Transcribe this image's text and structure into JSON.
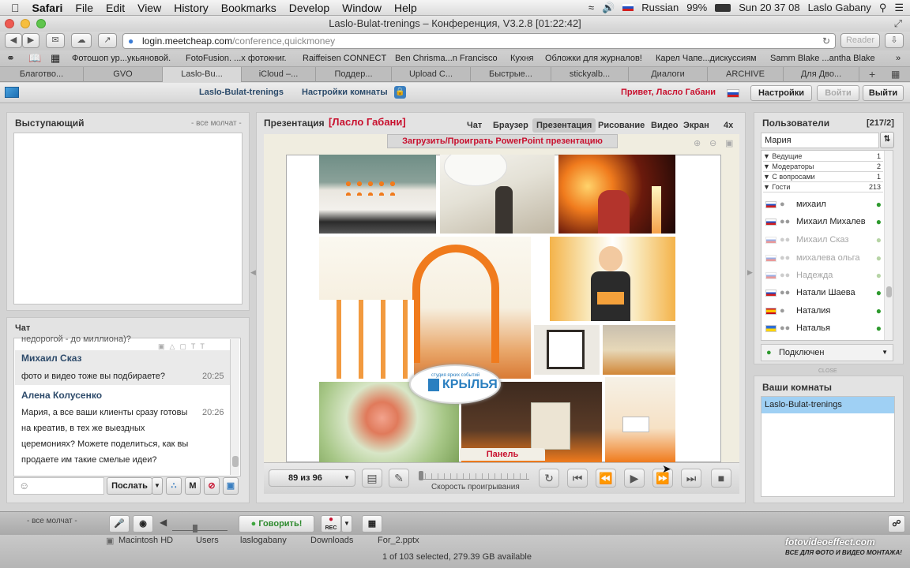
{
  "menubar": {
    "app": "Safari",
    "items": [
      "File",
      "Edit",
      "View",
      "History",
      "Bookmarks",
      "Develop",
      "Window",
      "Help"
    ],
    "language": "Russian",
    "battery": "99%",
    "clock": "Sun 20 37 08",
    "user": "Laslo Gabany"
  },
  "window": {
    "title": "Laslo-Bulat-trenings – Конференция, V3.2.8 [01:22:42]"
  },
  "toolbar": {
    "url_host": "login.meetcheap.com",
    "url_path": "/conference,quickmoney",
    "reader": "Reader"
  },
  "bookmarks": [
    "Фотошоп ур...укьяновой.",
    "FotoFusion. ...x фотокниг.",
    "Raiffeisen CONNECT",
    "Ben Chrisma...n Francisco",
    "Кухня",
    "Обложки для журналов!",
    "Карел Чапе...дискуссиям",
    "Samm Blake ...antha Blake"
  ],
  "tabs": [
    "Благотво...",
    "GVO",
    "Laslo-Bu...",
    "iCloud –...",
    "Поддер...",
    "Upload C...",
    "Быстрые...",
    "stickyalb...",
    "Диалоги",
    "ARCHIVE",
    "Для Дво..."
  ],
  "appbar": {
    "room": "Laslo-Bulat-trenings",
    "room_settings": "Настройки комнаты",
    "greeting": "Привет, Ласло Габани",
    "settings": "Настройки",
    "login": "Войти",
    "logout": "Выйти"
  },
  "speaker": {
    "title": "Выступающий",
    "status": "- все молчат -"
  },
  "chat": {
    "title": "Чат",
    "partial_line": "недорогой - до миллиона)?",
    "messages": [
      {
        "name": "Михаил Сказ",
        "lines": [
          "фото и видео тоже вы подбираете?"
        ],
        "time": "20:25"
      },
      {
        "name": "Алена Колусенко",
        "lines": [
          "Мария, а все ваши клиенты сразу готовы",
          "на креатив, в тех же выездных",
          "церемониях? Можете поделиться, как вы",
          "продаете им такие смелые идеи?"
        ],
        "time": "20:26"
      }
    ],
    "send": "Послать"
  },
  "presentation": {
    "title": "Презентация",
    "presenter": "[Ласло Габани]",
    "tabs": [
      "Чат",
      "Браузер",
      "Презентация",
      "Рисование",
      "Видео",
      "Экран",
      "4x"
    ],
    "active_tab": "Презентация",
    "upload_banner": "Загрузить/Проиграть PowerPoint презентацию",
    "logo_top": "студия ярких событий",
    "logo_text": "КРЫЛЬЯ",
    "control_panel": "Панель управления",
    "page_counter": "89 из 96",
    "speed_label": "Скорость проигрывания"
  },
  "users": {
    "title": "Пользователи",
    "count": "[217/2]",
    "search_value": "Мария",
    "groups": [
      {
        "label": "Ведущие",
        "count": "1"
      },
      {
        "label": "Модераторы",
        "count": "2"
      },
      {
        "label": "С вопросами",
        "count": "1"
      },
      {
        "label": "Гости",
        "count": "213"
      }
    ],
    "list": [
      {
        "name": "михаил",
        "flag": "ru",
        "active": true
      },
      {
        "name": "Михаил Михалев",
        "flag": "ru",
        "active": true
      },
      {
        "name": "Михаил Сказ",
        "flag": "ru",
        "active": false
      },
      {
        "name": "михалева ольга",
        "flag": "ru",
        "active": false
      },
      {
        "name": "Надежда",
        "flag": "ru",
        "active": false
      },
      {
        "name": "Натали Шаева",
        "flag": "ru",
        "active": true
      },
      {
        "name": "Наталия",
        "flag": "es",
        "active": true
      },
      {
        "name": "Наталья",
        "flag": "ua",
        "active": true
      }
    ],
    "status_select": "Подключен",
    "close": "CLOSE"
  },
  "rooms": {
    "title": "Ваши комнаты",
    "items": [
      "Laslo-Bulat-trenings"
    ]
  },
  "bottombar": {
    "status": "- все молчат -",
    "talk": "Говорить!",
    "rec": "REC"
  },
  "finder": {
    "path": [
      "Macintosh HD",
      "Users",
      "laslogabany",
      "Downloads",
      "For_2.pptx"
    ],
    "status": "1 of 103 selected, 279.39 GB available",
    "watermark": "fotovideoeffect.com",
    "watermark_sub": "ВСЕ ДЛЯ ФОТО И ВИДЕО МОНТАЖА!"
  },
  "colors": {
    "accent_red": "#c8102e",
    "link_blue": "#2b4a6a",
    "selected_room": "#9fd0f4",
    "talk_green": "#3fa63f"
  }
}
